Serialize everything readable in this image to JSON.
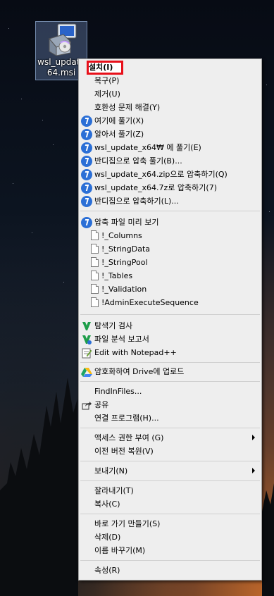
{
  "desktop": {
    "file_label": "wsl_update_x64.msi",
    "file_label_display": "wsl_update\n64.msi"
  },
  "context_menu": {
    "install": "설치(I)",
    "repair": "복구(P)",
    "uninstall": "제거(U)",
    "compat": "호환성 문제 해결(Y)",
    "extract_here": "여기에 풀기(X)",
    "extract_auto": "알아서 풀기(Z)",
    "extract_to_folder": "wsl_update_x64₩ 에 풀기(E)",
    "bandizip_extract": "반디집으로 압축 풀기(B)...",
    "compress_zip": "wsl_update_x64.zip으로 압축하기(Q)",
    "compress_7z": "wsl_update_x64.7z로 압축하기(7)",
    "bandizip_compress": "반디집으로 압축하기(L)...",
    "preview_title": "압축 파일 미리 보기",
    "preview_files": [
      "!_Columns",
      "!_StringData",
      "!_StringPool",
      "!_Tables",
      "!_Validation",
      "!AdminExecuteSequence"
    ],
    "scan": "탐색기 검사",
    "analysis_report": "파일 분석 보고서",
    "notepadpp": "Edit with Notepad++",
    "drive_upload": "암호화하여 Drive에 업로드",
    "findinfiles": "FindInFiles...",
    "share": "공유",
    "open_with": "연결 프로그램(H)...",
    "grant_access": "액세스 권한 부여 (G)",
    "restore_prev": "이전 버전 복원(V)",
    "send_to": "보내기(N)",
    "cut": "잘라내기(T)",
    "copy": "복사(C)",
    "create_shortcut": "바로 가기 만들기(S)",
    "delete": "삭제(D)",
    "rename": "이름 바꾸기(M)",
    "properties": "속성(R)"
  },
  "colors": {
    "menu_bg": "#eeeeee",
    "highlight_border": "#e8101a",
    "bandizip_blue": "#2b6fd6",
    "scan_green": "#1e9e4a"
  }
}
